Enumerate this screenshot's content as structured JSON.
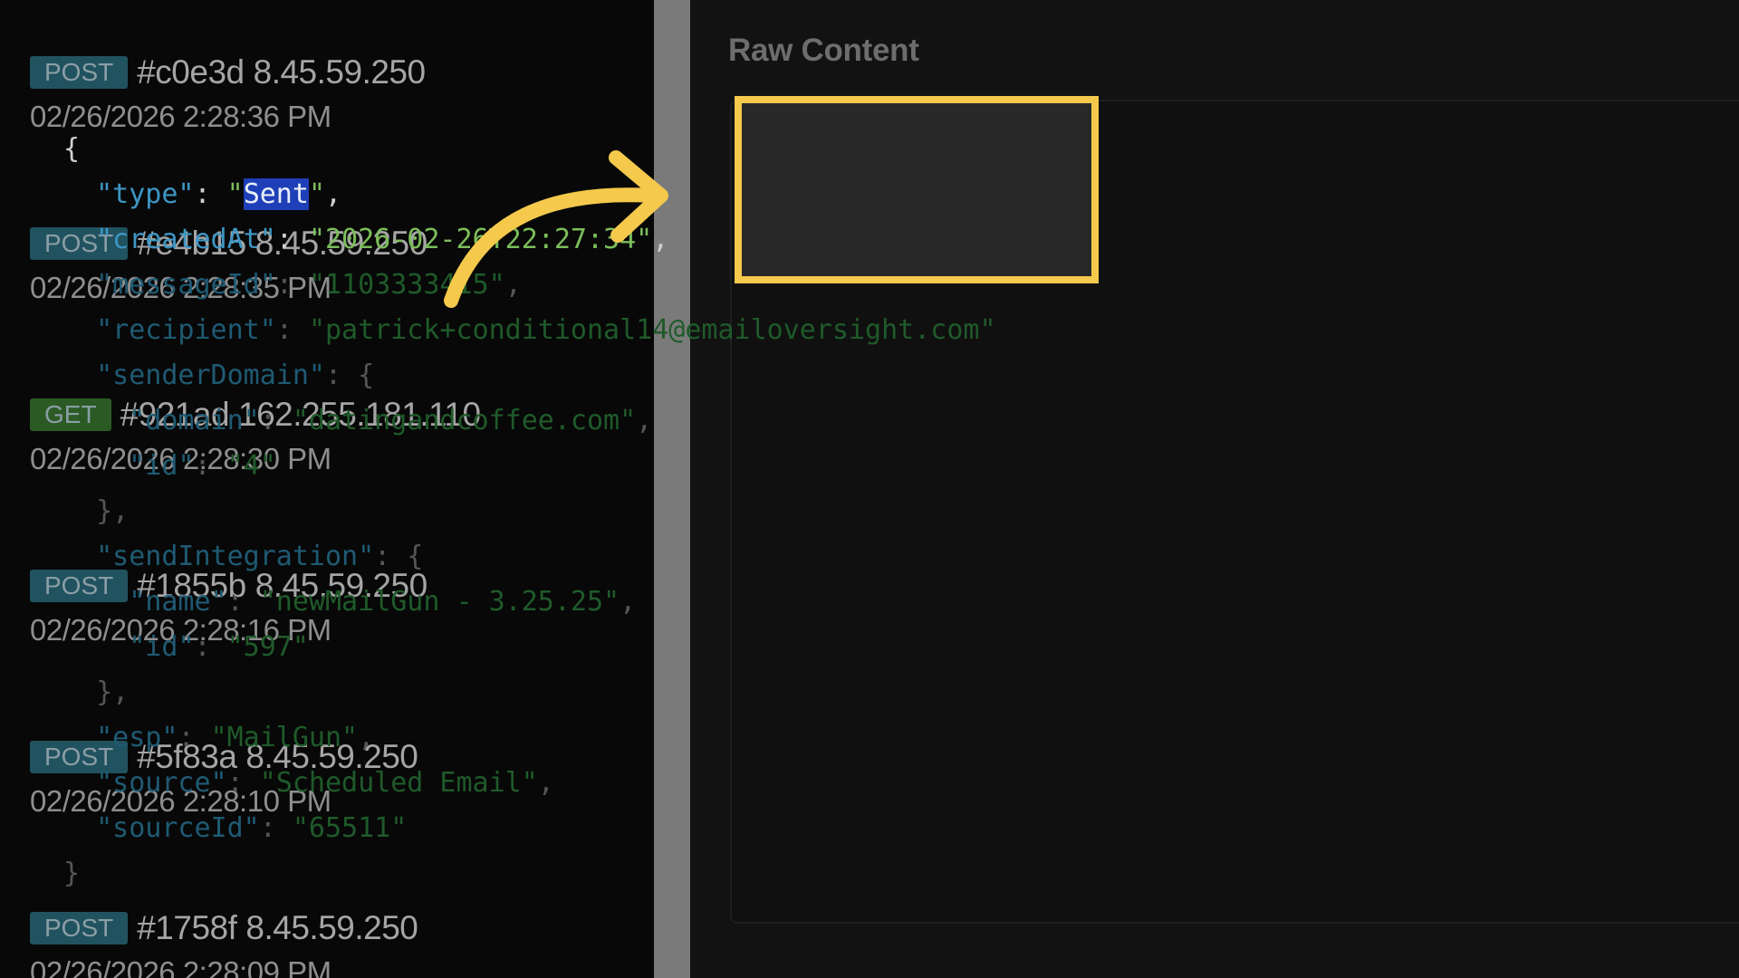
{
  "requests": [
    {
      "method": "POST",
      "id": "#c0e3d",
      "ip": "8.45.59.250",
      "time": "02/26/2026 2:28:36 PM"
    },
    {
      "method": "POST",
      "id": "#e4b15",
      "ip": "8.45.59.250",
      "time": "02/26/2026 2:28:35 PM"
    },
    {
      "method": "GET",
      "id": "#921ad",
      "ip": "162.255.181.110",
      "time": "02/26/2026 2:28:30 PM"
    },
    {
      "method": "POST",
      "id": "#1855b",
      "ip": "8.45.59.250",
      "time": "02/26/2026 2:28:16 PM"
    },
    {
      "method": "POST",
      "id": "#5f83a",
      "ip": "8.45.59.250",
      "time": "02/26/2026 2:28:10 PM"
    },
    {
      "method": "POST",
      "id": "#1758f",
      "ip": "8.45.59.250",
      "time": "02/26/2026 2:28:09 PM"
    }
  ],
  "panel": {
    "title": "Raw Content"
  },
  "json": {
    "open_brace": "{",
    "close_brace": "}",
    "type_key": "\"type\"",
    "type_val": "Sent",
    "createdAt_key": "\"createdAt\"",
    "createdAt_val": "\"2026-02-26T22:27:34\"",
    "messageId_key": "\"messageId\"",
    "messageId_val": "\"1103333415\"",
    "recipient_key": "\"recipient\"",
    "recipient_val": "\"patrick+conditional14@emailoversight.com\"",
    "senderDomain_key": "\"senderDomain\"",
    "domain_key": "\"domain\"",
    "domain_val": "\"datingandcoffee.com\"",
    "sd_id_key": "\"id\"",
    "sd_id_val": "\"4\"",
    "sendIntegration_key": "\"sendIntegration\"",
    "name_key": "\"name\"",
    "name_val": "\"newMailGun - 3.25.25\"",
    "si_id_key": "\"id\"",
    "si_id_val": "\"597\"",
    "esp_key": "\"esp\"",
    "esp_val": "\"MailGun\"",
    "source_key": "\"source\"",
    "source_val": "\"Scheduled Email\"",
    "sourceId_key": "\"sourceId\"",
    "sourceId_val": "\"65511\""
  },
  "colors": {
    "highlight_box": "#f4c94c",
    "arrow": "#f4c94c",
    "selection": "#1f3fb8"
  },
  "icons": {
    "annotation": "curved-arrow-icon"
  }
}
